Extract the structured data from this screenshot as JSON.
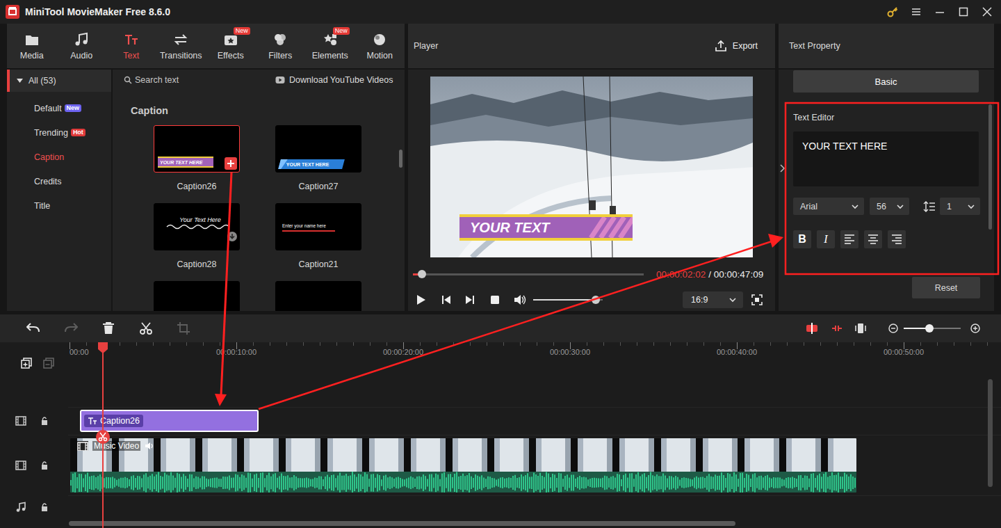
{
  "window": {
    "title": "MiniTool MovieMaker Free 8.6.0"
  },
  "nav_tabs": [
    {
      "label": "Media",
      "kind": "media",
      "selected": false
    },
    {
      "label": "Audio",
      "kind": "audio",
      "selected": false
    },
    {
      "label": "Text",
      "kind": "text",
      "selected": true
    },
    {
      "label": "Transitions",
      "kind": "transitions",
      "selected": false
    },
    {
      "label": "Effects",
      "kind": "effects",
      "selected": false,
      "badge": "New"
    },
    {
      "label": "Filters",
      "kind": "filters",
      "selected": false
    },
    {
      "label": "Elements",
      "kind": "elements",
      "selected": false,
      "badge": "New"
    },
    {
      "label": "Motion",
      "kind": "motion",
      "selected": false
    }
  ],
  "library": {
    "group": {
      "label": "All (53)",
      "expanded": true
    },
    "categories": [
      {
        "label": "Default",
        "selected": false,
        "badge": "New",
        "color": "#6d63f0"
      },
      {
        "label": "Trending",
        "selected": false,
        "badge": "Hot",
        "color": "#e03a3a"
      },
      {
        "label": "Caption",
        "selected": true
      },
      {
        "label": "Credits",
        "selected": false
      },
      {
        "label": "Title",
        "selected": false
      }
    ],
    "search": {
      "placeholder": "Search text"
    },
    "download": "Download YouTube Videos",
    "section": "Caption",
    "thumbnails": [
      {
        "name": "Caption26",
        "kind": "bar",
        "preview": "YOUR TEXT HERE",
        "selected": true,
        "action": "add"
      },
      {
        "name": "Caption27",
        "kind": "ribbon",
        "preview": "YOUR TEXT HERE",
        "selected": false
      },
      {
        "name": "Caption28",
        "kind": "script",
        "preview": "Your Text Here",
        "selected": false,
        "action": "download"
      },
      {
        "name": "Caption21",
        "kind": "line",
        "preview": "Enter your name here",
        "selected": false
      },
      {
        "kind": "blank",
        "selected": false
      },
      {
        "kind": "blank",
        "selected": false
      }
    ]
  },
  "player": {
    "title": "Player",
    "export": "Export",
    "caption": "YOUR TEXT",
    "progress": 0.04,
    "current_time": "00:00:02:02",
    "total_time": "/ 00:00:47:09",
    "volume": 0.9,
    "aspect": "16:9"
  },
  "text_property": {
    "title": "Text Property",
    "tabs": [
      {
        "label": "Basic",
        "selected": true
      }
    ],
    "editor": {
      "label": "Text Editor",
      "value": "YOUR TEXT HERE",
      "font": "Arial",
      "size": "56",
      "line_spacing": "1"
    },
    "formats": [
      {
        "kind": "bold",
        "glyph": "B"
      },
      {
        "kind": "italic",
        "glyph": "I"
      },
      {
        "kind": "align-left"
      },
      {
        "kind": "align-center"
      },
      {
        "kind": "align-right"
      }
    ],
    "reset": "Reset"
  },
  "timeline": {
    "tools": [
      {
        "kind": "undo",
        "disabled": false
      },
      {
        "kind": "redo",
        "disabled": true
      },
      {
        "kind": "delete",
        "disabled": false
      },
      {
        "kind": "split",
        "disabled": false
      },
      {
        "kind": "crop",
        "disabled": true
      }
    ],
    "zoom": 0.45,
    "ruler": [
      "00:00",
      "00:00:10:00",
      "00:00:20:00",
      "00:00:30:00",
      "00:00:40:00",
      "00:00:50:00"
    ],
    "tracks": [
      {
        "kind": "text",
        "clips": [
          {
            "label": "Caption26",
            "selected": true
          }
        ]
      },
      {
        "kind": "video",
        "clips": [
          {
            "label": "Music Video",
            "selected": false
          }
        ]
      },
      {
        "kind": "audio",
        "clips": []
      }
    ]
  }
}
